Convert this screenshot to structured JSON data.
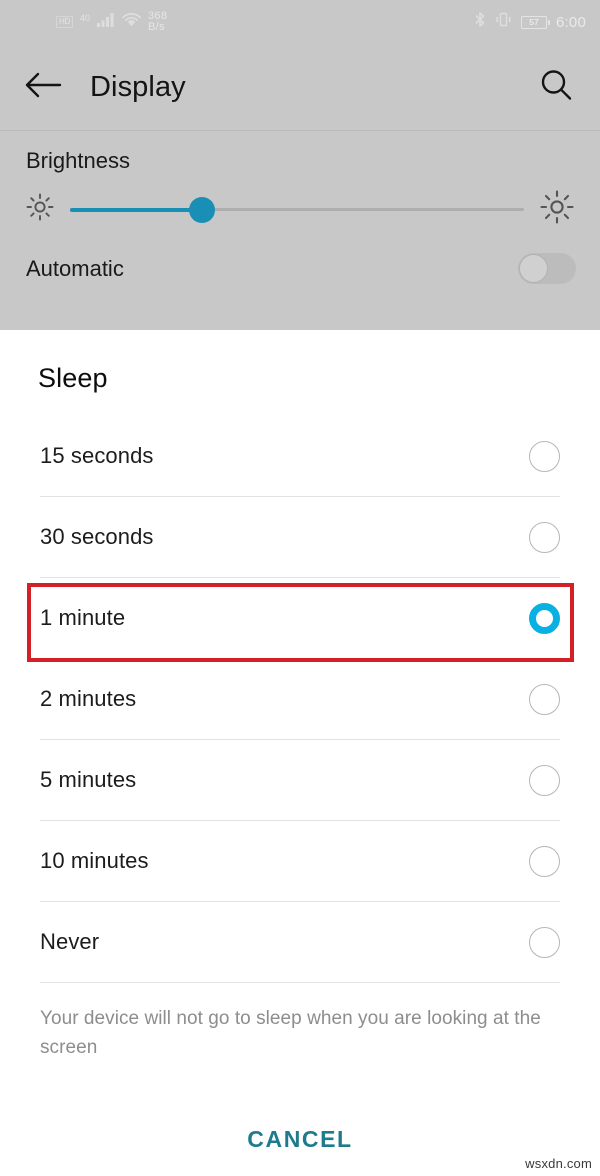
{
  "status_bar": {
    "sim_label": "HD",
    "network_type": "40",
    "net_speed_value": "368",
    "net_speed_unit": "B/s",
    "battery_percent": "57",
    "time": "6:00",
    "icons": [
      "sim-card-icon",
      "signal-bars-icon",
      "wifi-icon",
      "bluetooth-icon",
      "vibrate-icon",
      "battery-icon"
    ]
  },
  "app_bar": {
    "title": "Display",
    "back_icon": "arrow-left-icon",
    "search_icon": "search-icon"
  },
  "brightness": {
    "label": "Brightness",
    "low_icon": "brightness-low-icon",
    "high_icon": "brightness-high-icon",
    "value_percent": 29,
    "accent_color": "#1a8fb5"
  },
  "automatic": {
    "label": "Automatic",
    "enabled": false
  },
  "dialog": {
    "title": "Sleep",
    "selected_value": "1 minute",
    "accent_color": "#09b0e2",
    "highlight_color": "#d42027",
    "options": [
      {
        "label": "15 seconds",
        "selected": false
      },
      {
        "label": "30 seconds",
        "selected": false
      },
      {
        "label": "1 minute",
        "selected": true
      },
      {
        "label": "2 minutes",
        "selected": false
      },
      {
        "label": "5 minutes",
        "selected": false
      },
      {
        "label": "10 minutes",
        "selected": false
      },
      {
        "label": "Never",
        "selected": false
      }
    ],
    "footer_note": "Your device will not go to sleep when you are looking at the screen",
    "cancel_label": "CANCEL"
  },
  "watermark": "wsxdn.com"
}
